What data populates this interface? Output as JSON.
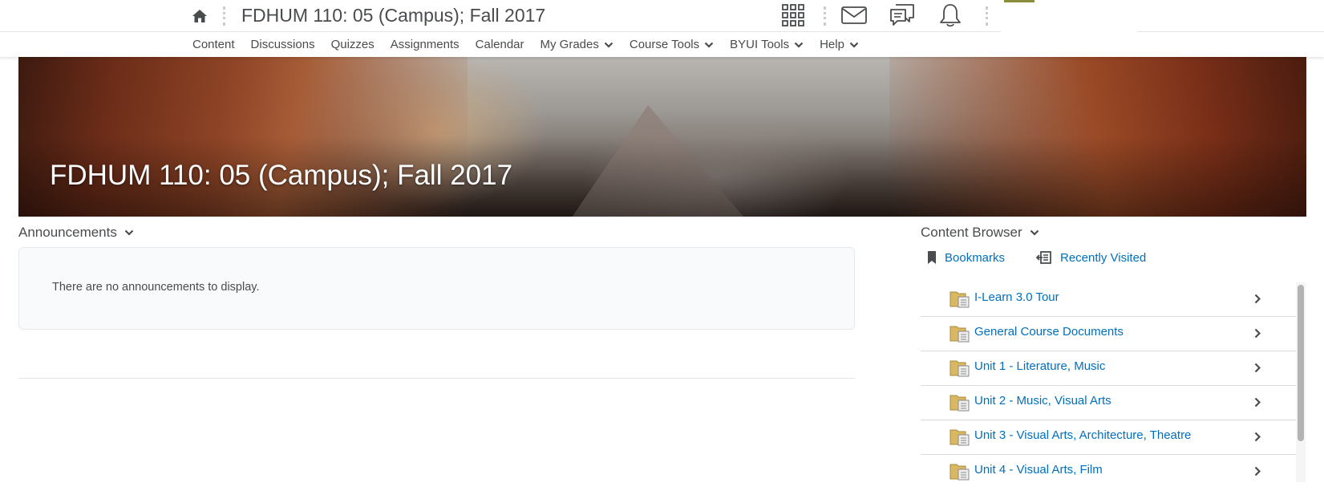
{
  "topbar": {
    "course_title": "FDHUM 110: 05 (Campus); Fall 2017",
    "home_icon": "home-icon",
    "icons": [
      "grid-icon",
      "mail-icon",
      "chat-bubbles-icon",
      "bell-icon"
    ]
  },
  "navbar": {
    "items": [
      {
        "label": "Content",
        "dropdown": false
      },
      {
        "label": "Discussions",
        "dropdown": false
      },
      {
        "label": "Quizzes",
        "dropdown": false
      },
      {
        "label": "Assignments",
        "dropdown": false
      },
      {
        "label": "Calendar",
        "dropdown": false
      },
      {
        "label": "My Grades",
        "dropdown": true
      },
      {
        "label": "Course Tools",
        "dropdown": true
      },
      {
        "label": "BYUI Tools",
        "dropdown": true
      },
      {
        "label": "Help",
        "dropdown": true
      }
    ]
  },
  "banner": {
    "title": "FDHUM 110: 05 (Campus); Fall 2017"
  },
  "announcements": {
    "title": "Announcements",
    "empty_text": "There are no announcements to display."
  },
  "content_browser": {
    "title": "Content Browser",
    "bookmarks_label": "Bookmarks",
    "recently_visited_label": "Recently Visited",
    "items": [
      "I-Learn 3.0 Tour",
      "General Course Documents",
      "Unit 1 - Literature, Music",
      "Unit 2 - Music, Visual Arts",
      "Unit 3 - Visual Arts, Architecture, Theatre",
      "Unit 4 - Visual Arts, Film"
    ]
  },
  "colors": {
    "link": "#006fbf",
    "text": "#494c4e",
    "divider": "#e3e5e8"
  }
}
